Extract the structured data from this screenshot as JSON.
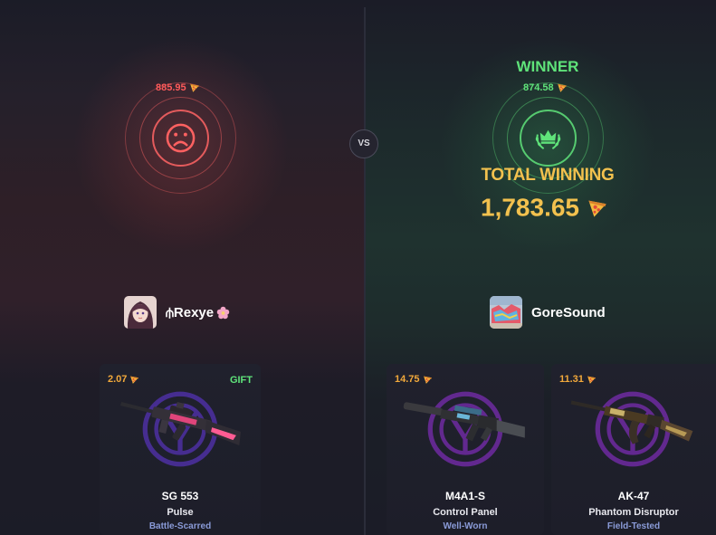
{
  "vs_label": "VS",
  "left_player": {
    "name": "⫛Rexye",
    "amount": "885.95",
    "status_icon": "sad-face-icon",
    "accent": "#ff5a5a"
  },
  "right_player": {
    "name": "GoreSound",
    "amount": "874.58",
    "status_icon": "crown-laurel-icon",
    "winner_label": "WINNER",
    "accent": "#5fe37a"
  },
  "result": {
    "total_label": "TOTAL WINNING",
    "total_value": "1,783.65"
  },
  "currency_icon": "pizza-icon",
  "items": [
    {
      "price": "2.07",
      "badge": "GIFT",
      "weapon": "SG 553",
      "skin": "Pulse",
      "wear": "Battle-Scarred"
    },
    {
      "price": "14.75",
      "weapon": "M4A1-S",
      "skin": "Control Panel",
      "wear": "Well-Worn"
    },
    {
      "price": "11.31",
      "weapon": "AK-47",
      "skin": "Phantom Disruptor",
      "wear": "Field-Tested"
    }
  ]
}
